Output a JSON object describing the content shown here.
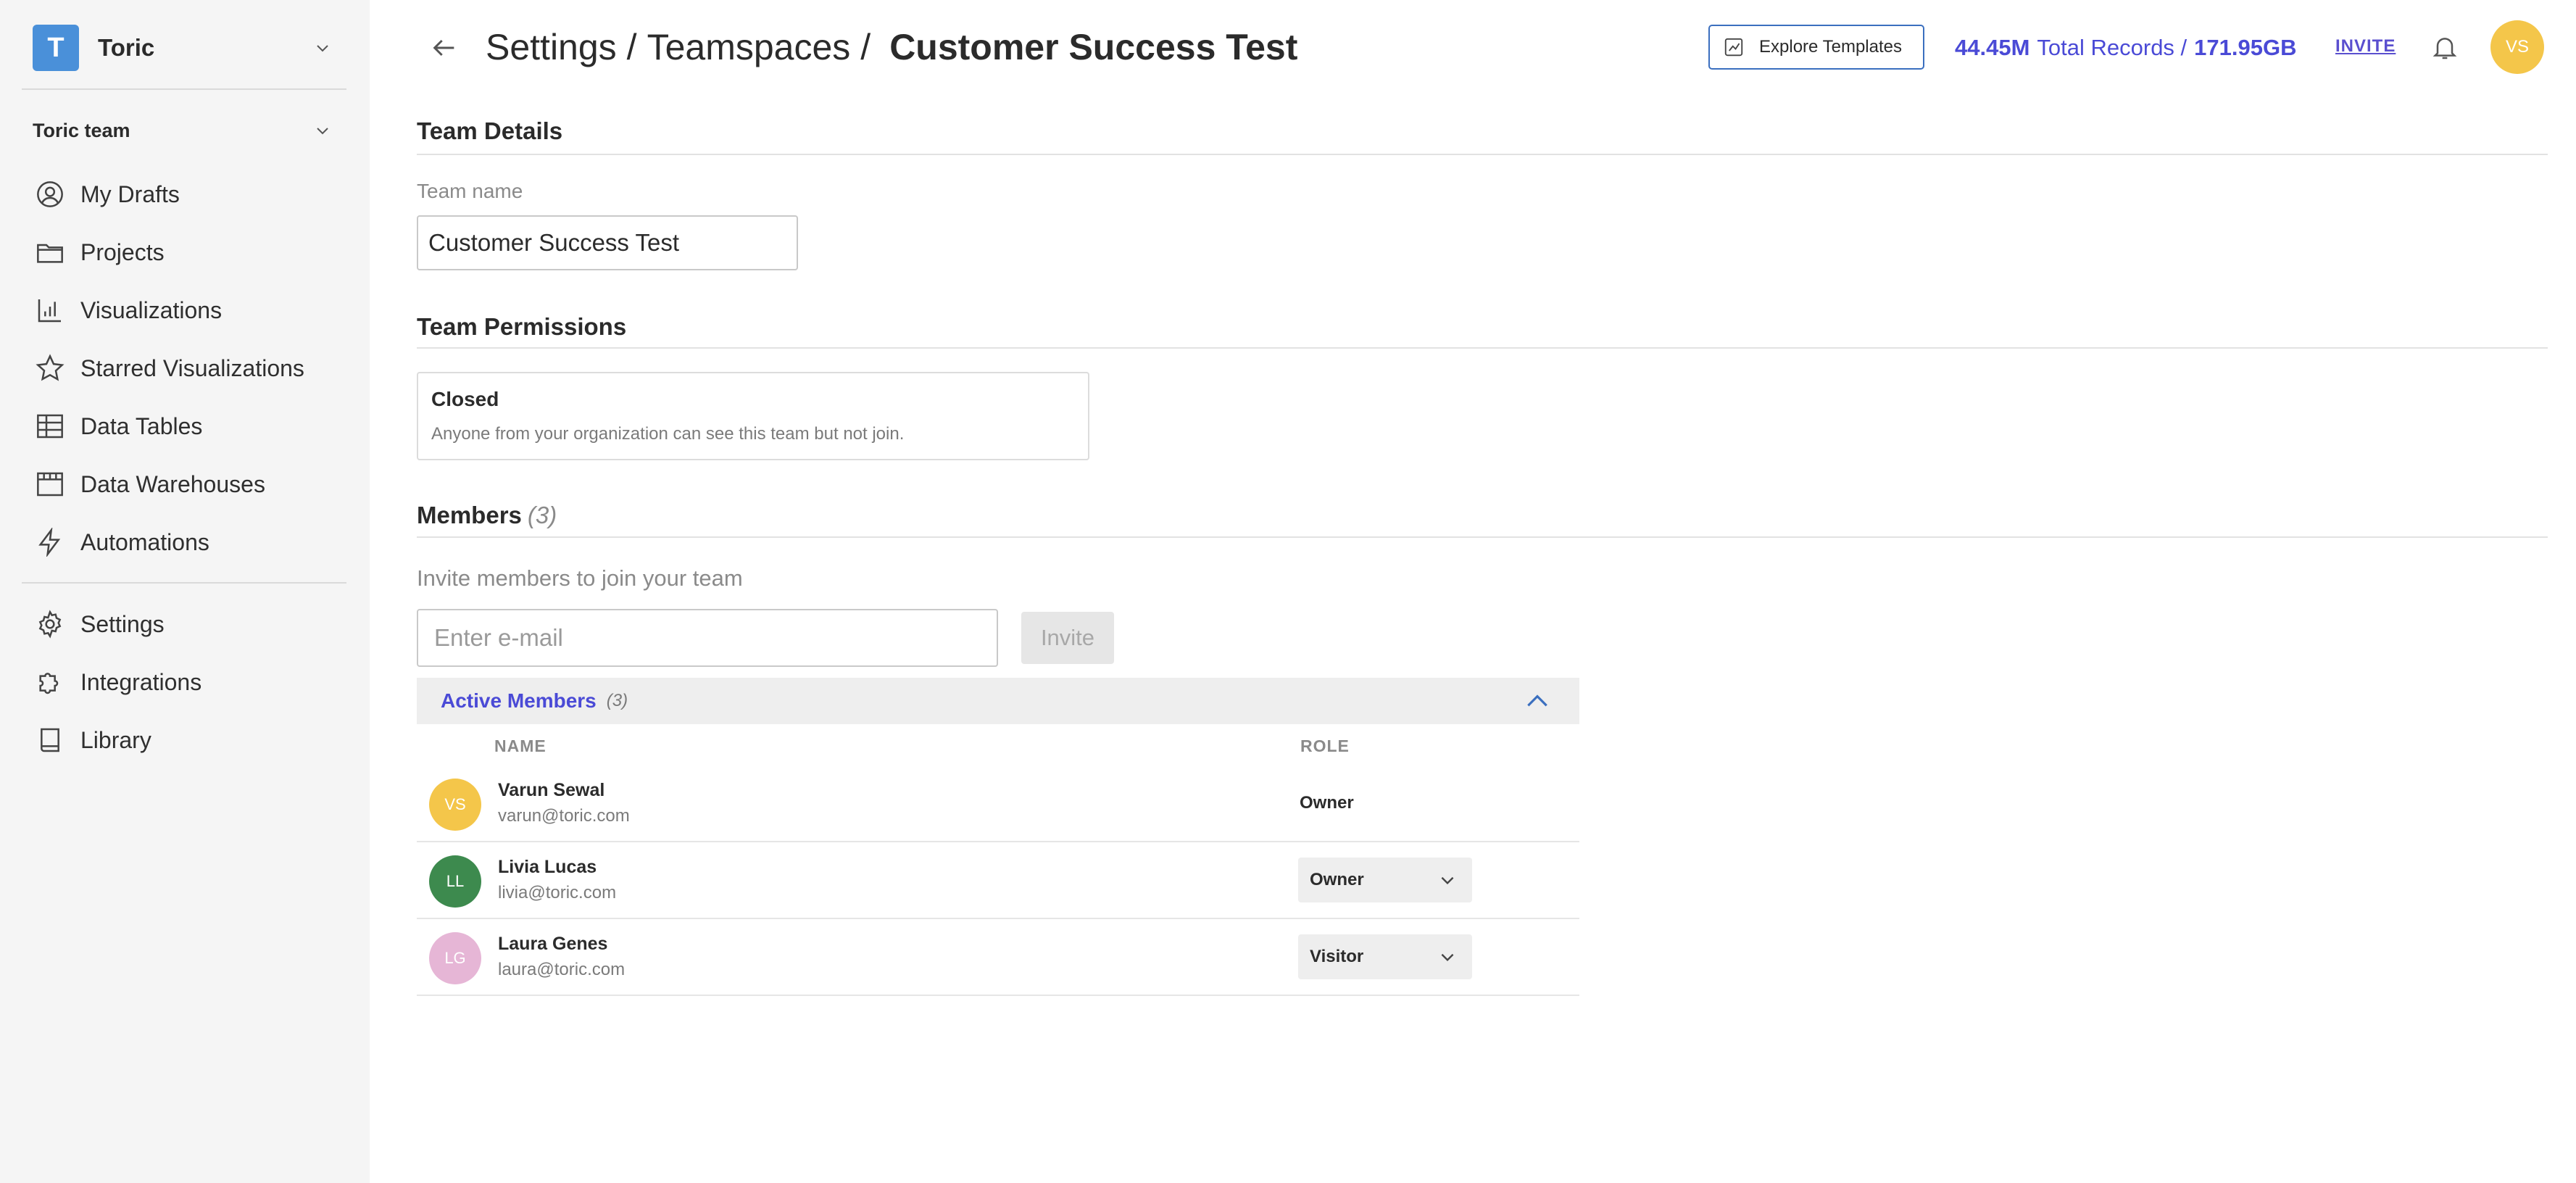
{
  "sidebar": {
    "workspace": {
      "initial": "T",
      "name": "Toric",
      "logo_color": "#4a90d9"
    },
    "team": {
      "name": "Toric team"
    },
    "items": [
      {
        "label": "My Drafts",
        "icon": "user-circle-icon"
      },
      {
        "label": "Projects",
        "icon": "folder-icon"
      },
      {
        "label": "Visualizations",
        "icon": "chart-icon"
      },
      {
        "label": "Starred Visualizations",
        "icon": "star-icon"
      },
      {
        "label": "Data Tables",
        "icon": "table-icon"
      },
      {
        "label": "Data Warehouses",
        "icon": "warehouse-icon"
      },
      {
        "label": "Automations",
        "icon": "bolt-icon"
      }
    ],
    "bottom_items": [
      {
        "label": "Settings",
        "icon": "gear-icon"
      },
      {
        "label": "Integrations",
        "icon": "puzzle-icon"
      },
      {
        "label": "Library",
        "icon": "book-icon"
      }
    ]
  },
  "header": {
    "breadcrumb": [
      "Settings",
      "Teamspaces"
    ],
    "separator": "/",
    "current": "Customer Success Test",
    "explore_label": "Explore Templates",
    "records_count": "44.45M",
    "records_label": "Total Records /",
    "storage": "171.95GB",
    "invite_label": "INVITE",
    "user_initials": "VS",
    "accent_color": "#4a4ad6"
  },
  "team_details": {
    "title": "Team Details",
    "name_label": "Team name",
    "name_value": "Customer Success Test"
  },
  "permissions": {
    "title": "Team Permissions",
    "option_title": "Closed",
    "option_desc": "Anyone from your organization can see this team but not join."
  },
  "members": {
    "title": "Members",
    "count": "(3)",
    "invite_prompt": "Invite members to join your team",
    "email_placeholder": "Enter e-mail",
    "invite_button": "Invite",
    "active_title": "Active Members",
    "active_count": "(3)",
    "col_name": "NAME",
    "col_role": "ROLE",
    "list": [
      {
        "initials": "VS",
        "name": "Varun Sewal",
        "email": "varun@toric.com",
        "role": "Owner",
        "editable": false,
        "color": "#f4c64a"
      },
      {
        "initials": "LL",
        "name": "Livia Lucas",
        "email": "livia@toric.com",
        "role": "Owner",
        "editable": true,
        "color": "#3d8a4e"
      },
      {
        "initials": "LG",
        "name": "Laura Genes",
        "email": "laura@toric.com",
        "role": "Visitor",
        "editable": true,
        "color": "#e6b6d6"
      }
    ]
  }
}
